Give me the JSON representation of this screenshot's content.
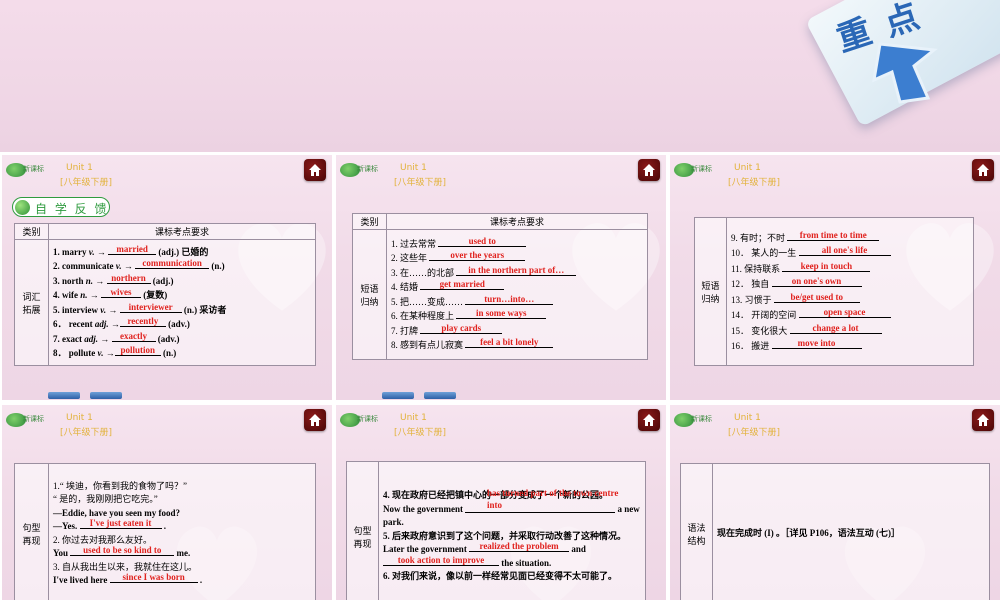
{
  "hero": {
    "badge_text": "重 点"
  },
  "header": {
    "brand": "新课标",
    "unit": "Unit 1",
    "subunit": "[八年级下册]"
  },
  "badge": {
    "self_check": "自 学 反 馈"
  },
  "table": {
    "col_category": "类别",
    "col_requirements": "课标考点要求"
  },
  "categories": {
    "vocab": "词汇\n拓展",
    "phrases": "短语\n归纳",
    "sentences": "句型\n再现",
    "grammar": "语法\n结构"
  },
  "vocab_items": [
    {
      "num": "1.",
      "word": "marry",
      "pos": "v.",
      "arrow": "→",
      "answer": "married",
      "after": "(adj.) 已婚的"
    },
    {
      "num": "2.",
      "word": "communicate",
      "pos": "v.",
      "arrow": "→",
      "answer": "communication",
      "after": "(n.)"
    },
    {
      "num": "3.",
      "word": "north",
      "pos": "n.",
      "arrow": "→",
      "answer": "northern",
      "after": "(adj.)"
    },
    {
      "num": "4.",
      "word": "wife",
      "pos": "n.",
      "arrow": "→",
      "answer": "wives",
      "after": "(复数)"
    },
    {
      "num": "5.",
      "word": "interview",
      "pos": "v.",
      "arrow": "→",
      "answer": "interviewer",
      "after": "(n.) 采访者"
    },
    {
      "num": "6．",
      "word": "recent",
      "pos": "adj.",
      "arrow": "→",
      "answer": "recently",
      "after": "(adv.)"
    },
    {
      "num": "7.",
      "word": "exact",
      "pos": "adj.",
      "arrow": "→",
      "answer": "exactly",
      "after": "(adv.)"
    },
    {
      "num": "8．",
      "word": "pollute",
      "pos": "v.",
      "arrow": "→",
      "answer": "pollution",
      "after": "(n.)"
    }
  ],
  "phrases_a": [
    {
      "num": "1.",
      "cn": "过去常常",
      "answer": "used to"
    },
    {
      "num": "2.",
      "cn": "这些年",
      "answer": "over the years"
    },
    {
      "num": "3.",
      "cn": "在……的北部",
      "answer": "in the northern part of…"
    },
    {
      "num": "4.",
      "cn": "结婚",
      "answer": "get married"
    },
    {
      "num": "5.",
      "cn": "把……变成……",
      "answer": "turn…into…"
    },
    {
      "num": "6.",
      "cn": "在某种程度上",
      "answer": "in some ways"
    },
    {
      "num": "7.",
      "cn": "打牌",
      "answer": "play cards"
    },
    {
      "num": "8.",
      "cn": "感到有点儿寂寞",
      "answer": "feel a bit lonely"
    }
  ],
  "phrases_b": [
    {
      "num": "9.",
      "cn": "有时；不时",
      "answer": "from time to time"
    },
    {
      "num": "10．",
      "cn": "某人的一生",
      "answer": "all one's life"
    },
    {
      "num": "11.",
      "cn": "保持联系",
      "answer": "keep in touch"
    },
    {
      "num": "12．",
      "cn": "独自",
      "answer": "on one's own"
    },
    {
      "num": "13.",
      "cn": "习惯于",
      "answer": "be/get used to"
    },
    {
      "num": "14．",
      "cn": "开阔的空间",
      "answer": "open space"
    },
    {
      "num": "15．",
      "cn": "变化很大",
      "answer": "change a lot"
    },
    {
      "num": "16．",
      "cn": "搬进",
      "answer": "move into"
    }
  ],
  "sentences_a": {
    "s1_cn": "1.“ 埃迪，你看到我的食物了吗？”",
    "s1_cn2": "“ 是的，我刚刚把它吃完。”",
    "s1_en": "—Eddie, have you seen my food?",
    "s1_en2_pre": "—Yes.",
    "s1_ans": "I've just eaten it",
    "s1_en2_post": ".",
    "s2_cn": "2. 你过去对我那么友好。",
    "s2_pre": "You",
    "s2_ans": "used to be so kind to",
    "s2_post": "me.",
    "s3_cn": "3. 自从我出生以来，我就住在这儿。",
    "s3_pre": "I've lived here",
    "s3_ans": "since I was born",
    "s3_post": "."
  },
  "sentences_b": {
    "s4_cn": "4. 现在政府已经把镇中心的一部分变成了一个新的公园。",
    "s4_pre": "Now the government",
    "s4_ans": "has turned part of the town centre into",
    "s4_post": "a new park.",
    "s5_cn": "5. 后来政府意识到了这个问题，并采取行动改善了这种情况。",
    "s5_pre": "Later the government",
    "s5_ans1": "realized the problem",
    "s5_mid": "and",
    "s5_ans2": "took action to improve",
    "s5_post": "the situation.",
    "s6_cn": "6. 对我们来说，像以前一样经常见面已经变得不太可能了。"
  },
  "grammar": {
    "text": "现在完成时 (I) 。［详见 P106，语法互动 (七)］"
  }
}
